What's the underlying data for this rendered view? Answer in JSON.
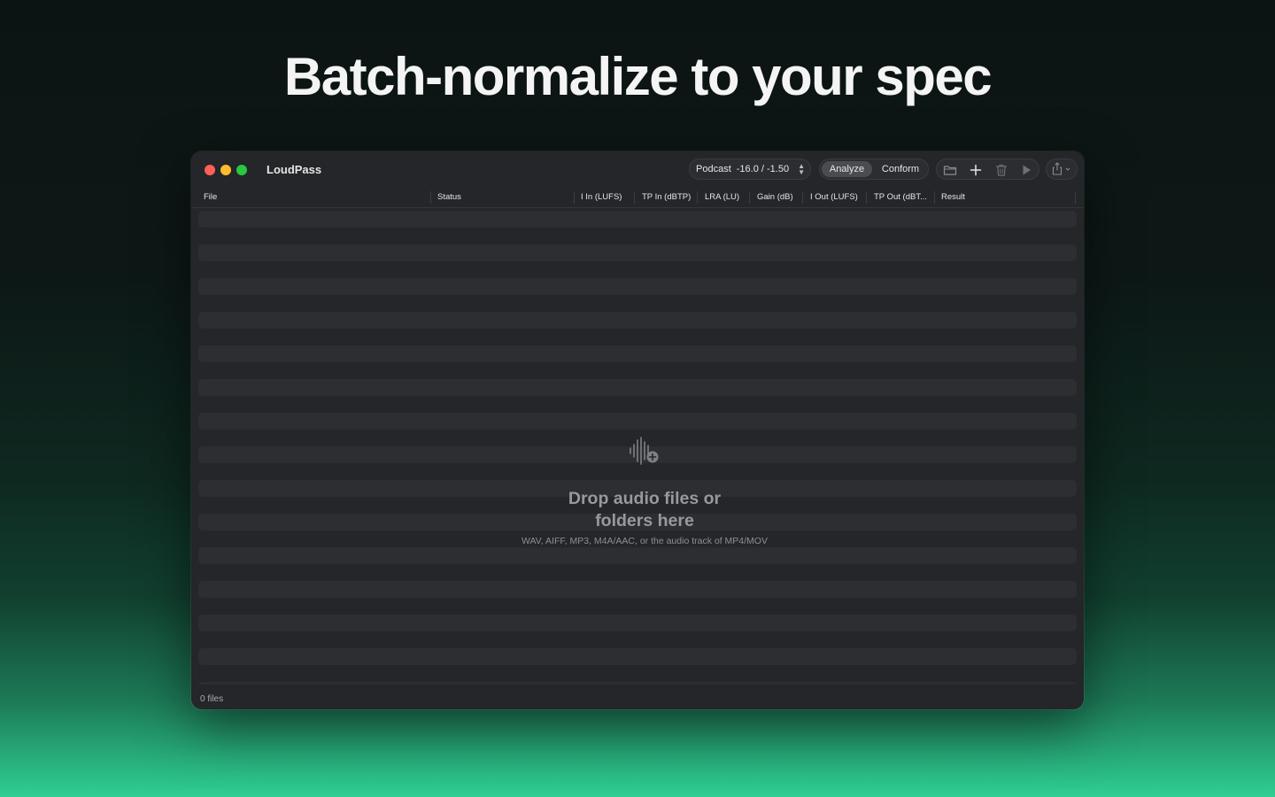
{
  "headline": "Batch-normalize to your spec",
  "window": {
    "app_title": "LoudPass"
  },
  "toolbar": {
    "preset_name": "Podcast",
    "preset_value": "-16.0 / -1.50",
    "mode_analyze": "Analyze",
    "mode_conform": "Conform",
    "selected_mode": "Analyze"
  },
  "table": {
    "columns": [
      "File",
      "Status",
      "I In (LUFS)",
      "TP In (dBTP)",
      "LRA (LU)",
      "Gain (dB)",
      "I Out (LUFS)",
      "TP Out (dBT...",
      "Result"
    ]
  },
  "empty_state": {
    "title": "Drop audio files or folders here",
    "subtitle": "WAV, AIFF, MP3, M4A/AAC, or the audio track of MP4/MOV"
  },
  "footer": {
    "file_count": "0 files"
  },
  "icons": {
    "empty": "waveform-plus-icon",
    "open": "folder-icon",
    "add": "plus-icon",
    "delete": "trash-icon",
    "run": "play-icon",
    "export": "share-icon"
  },
  "colors": {
    "close": "#fe5f57",
    "minimize": "#febc2e",
    "maximize": "#28c840",
    "accent_bottom": "#2fcf92"
  }
}
